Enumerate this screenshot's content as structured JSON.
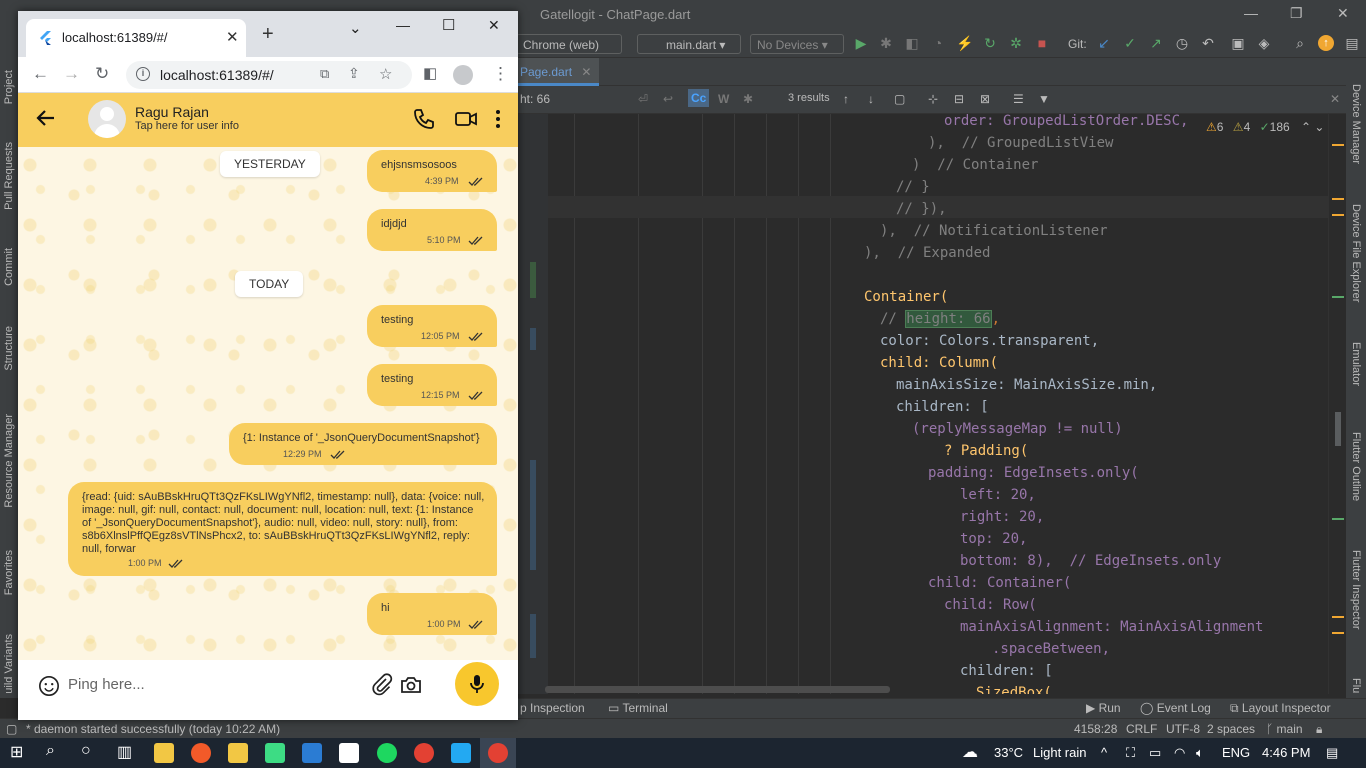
{
  "ide": {
    "title": "Gatellogit - ChatPage.dart",
    "device_selector": "Chrome (web)",
    "run_config": "main.dart",
    "no_devices": "No Devices",
    "git_label": "Git:",
    "tab_label": "Page.dart",
    "find_text": "ht: 66",
    "find_results": "3 results",
    "inspections": {
      "warnings": "6",
      "weak": "4",
      "typos": "186"
    },
    "code": {
      "l1": "order: GroupedListOrder.DESC,",
      "l2": "),  // GroupedListView",
      "l3": ")  // Container",
      "l4": "// }",
      "l5": "// }),",
      "l6": "),  // NotificationListener",
      "l7": "),  // Expanded",
      "l8": "Container(",
      "l9a": "// ",
      "l9b": "height: 66",
      "l9c": ",",
      "l10": "color: Colors.transparent,",
      "l11": "child: Column(",
      "l12": "mainAxisSize: MainAxisSize.min,",
      "l13": "children: [",
      "l14": "(replyMessageMap != null)",
      "l15": "? Padding(",
      "l16": "padding: EdgeInsets.only(",
      "l17": "left: 20,",
      "l18": "right: 20,",
      "l19": "top: 20,",
      "l20": "bottom: 8),  // EdgeInsets.only",
      "l21": "child: Container(",
      "l22": "child: Row(",
      "l23": "mainAxisAlignment: MainAxisAlignment",
      "l24": ".spaceBetween,",
      "l25": "children: [",
      "l26": "SizedBox("
    },
    "right_tools": [
      "Device Manager",
      "Device File Explorer",
      "Emulator",
      "Flutter Outline",
      "Flutter Inspector",
      "Flu"
    ],
    "left_tools": [
      "Project",
      "Pull Requests",
      "Commit",
      "Structure",
      "Resource Manager",
      "Favorites",
      "uild Variants"
    ],
    "bottom_tools": [
      "p Inspection",
      "Terminal",
      "Run",
      "Event Log",
      "Layout Inspector"
    ],
    "status": {
      "message": "* daemon started successfully (today 10:22 AM)",
      "position": "4158:28",
      "line_sep": "CRLF",
      "encoding": "UTF-8",
      "indent": "2 spaces",
      "branch": "main"
    }
  },
  "taskbar": {
    "weather_temp": "33°C",
    "weather_desc": "Light rain",
    "language": "ENG",
    "time": "4:46 PM"
  },
  "browser": {
    "tab_title": "localhost:61389/#/",
    "url": "localhost:61389/#/"
  },
  "chat": {
    "user_name": "Ragu Rajan",
    "user_subtitle": "Tap here for user info",
    "date_yesterday": "YESTERDAY",
    "date_today": "TODAY",
    "messages": [
      {
        "text": "ehjsnsmsosoos",
        "time": "4:39 PM"
      },
      {
        "text": "idjdjd",
        "time": "5:10 PM"
      },
      {
        "text": "testing",
        "time": "12:05 PM"
      },
      {
        "text": "testing",
        "time": "12:15 PM"
      },
      {
        "text": "{1: Instance of '_JsonQueryDocumentSnapshot'}",
        "time": "12:29 PM"
      },
      {
        "text": "{read: {uid: sAuBBskHruQTt3QzFKsLIWgYNfl2, timestamp: null}, data: {voice: null, image: null, gif: null, contact: null, document: null, location: null, text: {1: Instance of '_JsonQueryDocumentSnapshot'}, audio: null, video: null, story: null}, from: s8b6XlnslPffQEgz8sVTlNsPhcx2, to: sAuBBskHruQTt3QzFKsLIWgYNfl2, reply: null, forwar",
        "time": "1:00 PM"
      },
      {
        "text": "hi",
        "time": "1:00 PM"
      }
    ],
    "input_placeholder": "Ping here...",
    "accent": "#f8ce5e"
  }
}
